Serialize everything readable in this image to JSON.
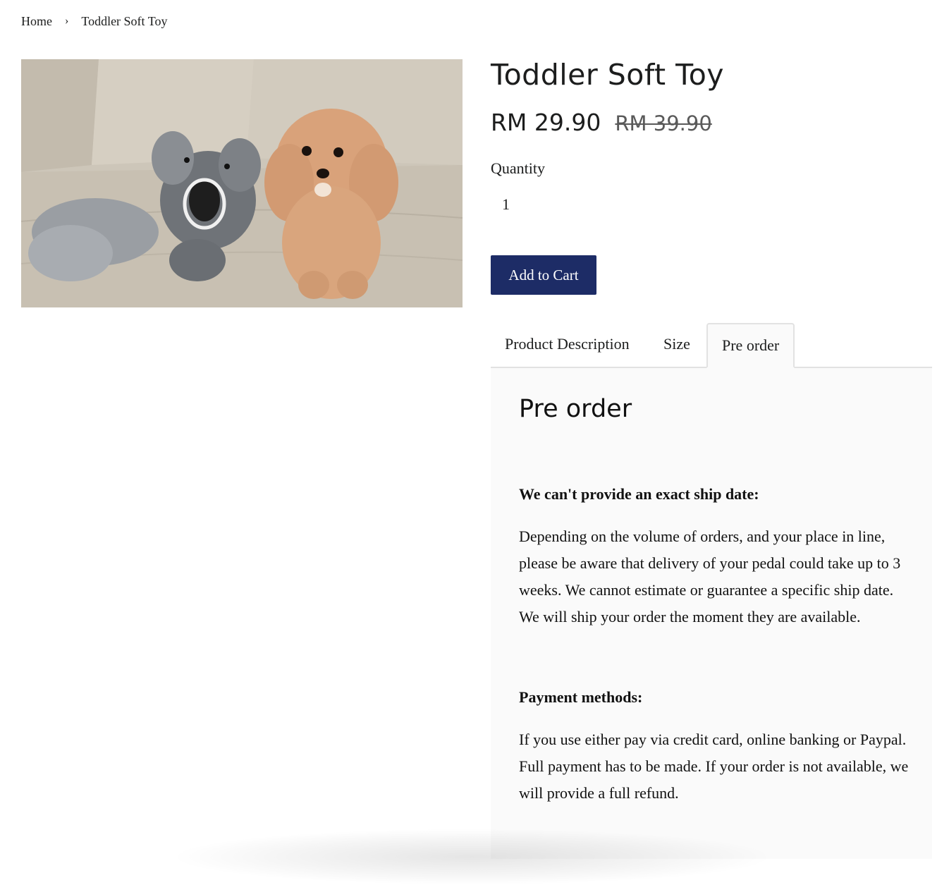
{
  "breadcrumb": {
    "home": "Home",
    "separator": "›",
    "current": "Toddler Soft Toy"
  },
  "product": {
    "title": "Toddler Soft Toy",
    "price": "RM 29.90",
    "compare_price": "RM 39.90",
    "quantity_label": "Quantity",
    "quantity_value": "1",
    "add_to_cart_label": "Add to Cart",
    "image_subject": "grey elephant plush toy next to apricot toy poodle on a sofa"
  },
  "tabs": [
    {
      "label": "Product Description",
      "active": false
    },
    {
      "label": "Size",
      "active": false
    },
    {
      "label": "Pre order",
      "active": true
    }
  ],
  "panel": {
    "heading": "Pre order",
    "ship_heading": "We can't provide an exact ship date:",
    "ship_text": "Depending on the volume of orders, and your place in line, please be aware that delivery of your pedal could take up to 3 weeks. We cannot estimate or guarantee a specific ship date. We will ship your order the moment they are available.",
    "payment_heading": "Payment methods:",
    "payment_text": "If you use either pay via credit card, online banking or Paypal. Full payment has to be made. If your order is not available, we will provide a full refund."
  },
  "colors": {
    "button_bg": "#1d2c66",
    "panel_bg": "#fafafa",
    "tab_border": "#e2e2e2"
  }
}
